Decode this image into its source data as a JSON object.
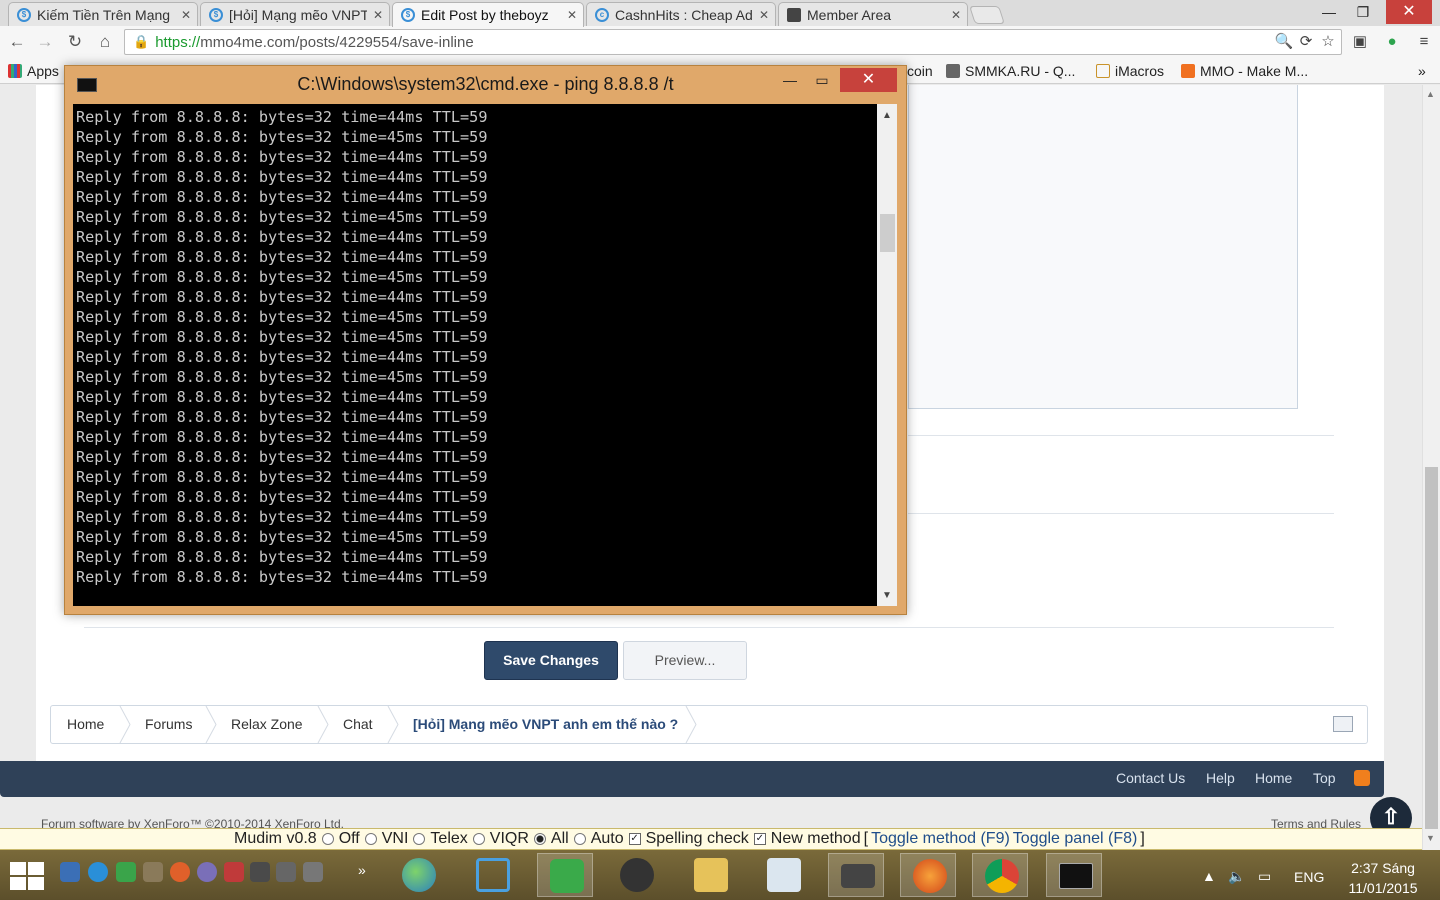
{
  "tabs": [
    {
      "label": "Kiếm Tiền Trên Mạng",
      "active": false
    },
    {
      "label": "[Hỏi] Mạng mẽo VNPT",
      "active": false
    },
    {
      "label": "Edit Post by theboyz",
      "active": true
    },
    {
      "label": "CashnHits : Cheap Ad",
      "active": false
    },
    {
      "label": "Member Area",
      "active": false
    }
  ],
  "omnibox": {
    "scheme": "https://",
    "rest": "mmo4me.com/posts/4229554/save-inline"
  },
  "bookmarks": [
    {
      "label": "Apps",
      "color": "#d33"
    },
    {
      "label": "coin",
      "color": ""
    },
    {
      "label": "SMMKA.RU - Q...",
      "color": "#555"
    },
    {
      "label": "iMacros",
      "color": "#e0a030"
    },
    {
      "label": "MMO - Make M...",
      "color": "#f07020"
    }
  ],
  "cmd": {
    "title": "C:\\Windows\\system32\\cmd.exe - ping  8.8.8.8 /t",
    "lines": [
      "Reply from 8.8.8.8: bytes=32 time=44ms TTL=59",
      "Reply from 8.8.8.8: bytes=32 time=45ms TTL=59",
      "Reply from 8.8.8.8: bytes=32 time=44ms TTL=59",
      "Reply from 8.8.8.8: bytes=32 time=44ms TTL=59",
      "Reply from 8.8.8.8: bytes=32 time=44ms TTL=59",
      "Reply from 8.8.8.8: bytes=32 time=45ms TTL=59",
      "Reply from 8.8.8.8: bytes=32 time=44ms TTL=59",
      "Reply from 8.8.8.8: bytes=32 time=44ms TTL=59",
      "Reply from 8.8.8.8: bytes=32 time=45ms TTL=59",
      "Reply from 8.8.8.8: bytes=32 time=44ms TTL=59",
      "Reply from 8.8.8.8: bytes=32 time=45ms TTL=59",
      "Reply from 8.8.8.8: bytes=32 time=45ms TTL=59",
      "Reply from 8.8.8.8: bytes=32 time=44ms TTL=59",
      "Reply from 8.8.8.8: bytes=32 time=45ms TTL=59",
      "Reply from 8.8.8.8: bytes=32 time=44ms TTL=59",
      "Reply from 8.8.8.8: bytes=32 time=44ms TTL=59",
      "Reply from 8.8.8.8: bytes=32 time=44ms TTL=59",
      "Reply from 8.8.8.8: bytes=32 time=44ms TTL=59",
      "Reply from 8.8.8.8: bytes=32 time=44ms TTL=59",
      "Reply from 8.8.8.8: bytes=32 time=44ms TTL=59",
      "Reply from 8.8.8.8: bytes=32 time=44ms TTL=59",
      "Reply from 8.8.8.8: bytes=32 time=45ms TTL=59",
      "Reply from 8.8.8.8: bytes=32 time=44ms TTL=59",
      "Reply from 8.8.8.8: bytes=32 time=44ms TTL=59"
    ]
  },
  "buttons": {
    "save": "Save Changes",
    "preview": "Preview..."
  },
  "breadcrumb": [
    "Home",
    "Forums",
    "Relax Zone",
    "Chat"
  ],
  "breadcrumb_current": "[Hỏi] Mạng mẽo VNPT anh em thế nào ?",
  "footer_links": [
    "Contact Us",
    "Help",
    "Home",
    "Top"
  ],
  "copyright": "Forum software by XenForo™ ©2010-2014 XenForo Ltd.",
  "terms": "Terms and Rules",
  "mudim": {
    "title": "Mudim v0.8",
    "options": [
      {
        "label": "Off",
        "checked": false
      },
      {
        "label": "VNI",
        "checked": false
      },
      {
        "label": "Telex",
        "checked": false
      },
      {
        "label": "VIQR",
        "checked": false
      },
      {
        "label": "All",
        "checked": true
      },
      {
        "label": "Auto",
        "checked": false
      }
    ],
    "checks": [
      {
        "label": "Spelling check",
        "checked": true
      },
      {
        "label": "New method",
        "checked": true
      }
    ],
    "toggle_method": "Toggle method (F9)",
    "toggle_panel": "Toggle panel (F8)"
  },
  "taskbar": {
    "lang": "ENG",
    "time": "2:37 Sáng",
    "date": "11/01/2015"
  }
}
